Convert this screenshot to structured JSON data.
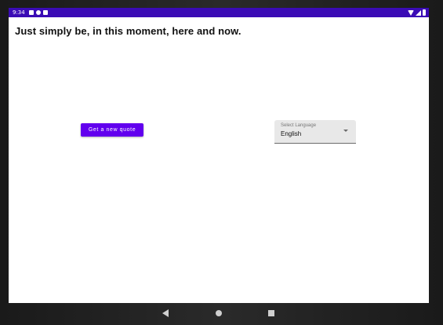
{
  "status_bar": {
    "time": "9:34",
    "left_icons": [
      "notification-icon",
      "sync-icon",
      "sim-icon"
    ],
    "right_icons": [
      "wifi-icon",
      "signal-icon",
      "battery-icon"
    ],
    "color": "#3a0bb5"
  },
  "main": {
    "quote": "Just simply be, in this moment, here and now.",
    "new_quote_button": "Get a new quote",
    "language_select": {
      "label": "Select Language",
      "value": "English"
    }
  },
  "nav_bar": {
    "icons": [
      "back-icon",
      "home-icon",
      "recents-icon"
    ]
  },
  "colors": {
    "accent": "#6200ee",
    "status_bar": "#3a0bb5"
  }
}
